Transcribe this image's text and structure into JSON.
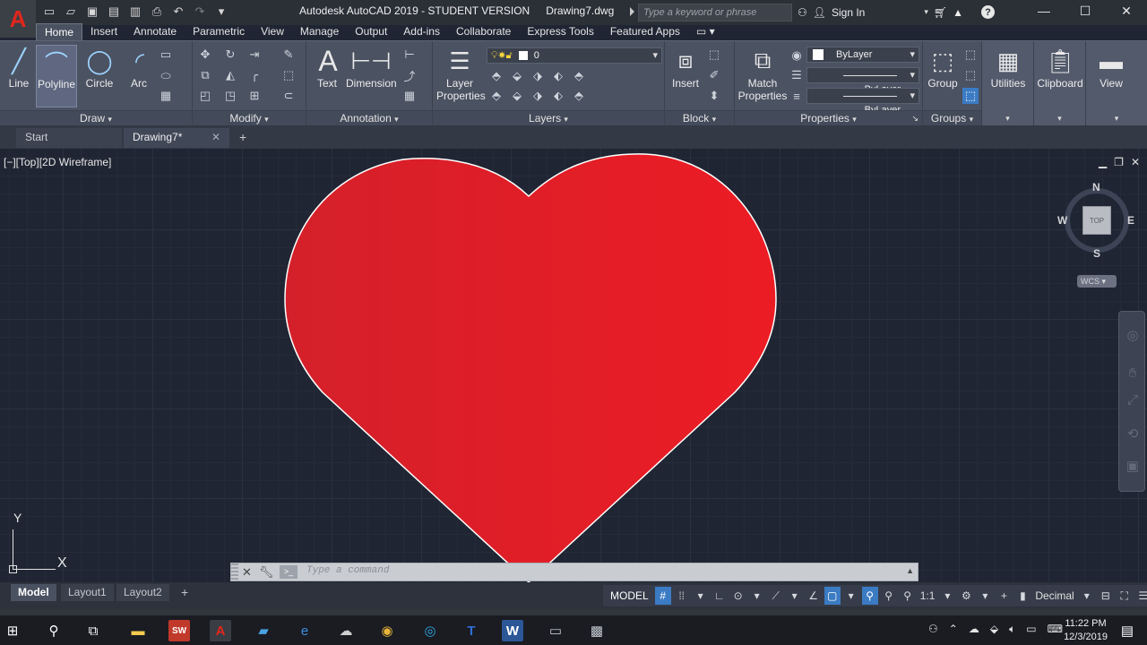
{
  "app": {
    "title_app": "Autodesk AutoCAD 2019 - STUDENT VERSION",
    "title_file": "Drawing7.dwg",
    "search_placeholder": "Type a keyword or phrase",
    "signin_label": "Sign In",
    "logo_letter": "A"
  },
  "ribbon_tabs": [
    "Home",
    "Insert",
    "Annotate",
    "Parametric",
    "View",
    "Manage",
    "Output",
    "Add-ins",
    "Collaborate",
    "Express Tools",
    "Featured Apps"
  ],
  "panels": {
    "draw": {
      "title": "Draw",
      "line": "Line",
      "polyline": "Polyline",
      "circle": "Circle",
      "arc": "Arc"
    },
    "modify": {
      "title": "Modify"
    },
    "annotation": {
      "title": "Annotation",
      "text": "Text",
      "dimension": "Dimension"
    },
    "layers": {
      "title": "Layers",
      "layer_properties_1": "Layer",
      "layer_properties_2": "Properties",
      "current_layer": "0"
    },
    "block": {
      "title": "Block",
      "insert": "Insert"
    },
    "properties": {
      "title": "Properties",
      "match_1": "Match",
      "match_2": "Properties",
      "color": "ByLayer",
      "linetype": "ByLayer",
      "lineweight": "ByLayer"
    },
    "groups": {
      "title": "Groups",
      "group": "Group"
    },
    "utilities": {
      "title": "Utilities"
    },
    "clipboard": {
      "title": "Clipboard"
    },
    "view": {
      "title": "View"
    }
  },
  "doc_tabs": {
    "start": "Start",
    "drawing": "Drawing7*"
  },
  "viewport": {
    "label": "[−][Top][2D Wireframe]",
    "viewcube_top": "TOP",
    "dir_n": "N",
    "dir_s": "S",
    "dir_e": "E",
    "dir_w": "W",
    "wcs": "WCS",
    "ucs_x": "X",
    "ucs_y": "Y"
  },
  "drawing": {
    "heart_fill": "#e31e24",
    "heart_stroke": "#ffffff"
  },
  "command": {
    "placeholder": "Type a command"
  },
  "layout_tabs": {
    "model": "Model",
    "layout1": "Layout1",
    "layout2": "Layout2"
  },
  "status": {
    "model": "MODEL",
    "scale": "1:1",
    "units": "Decimal"
  },
  "taskbar": {
    "time": "11:22 PM",
    "date": "12/3/2019"
  }
}
